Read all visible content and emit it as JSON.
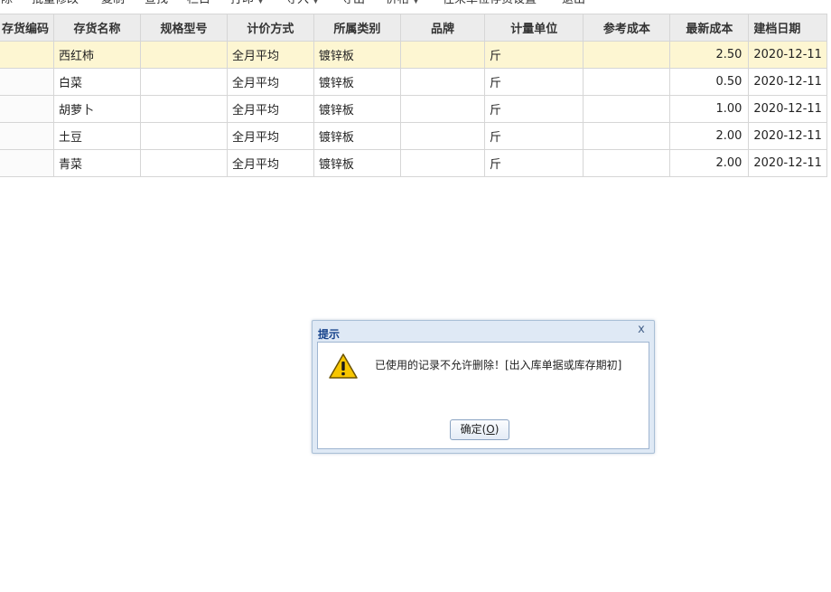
{
  "toolbar": {
    "items": [
      "删除",
      "批量修改",
      "复制",
      "查找",
      "栏目",
      "打印",
      "导入",
      "导出",
      "价格",
      "往来单位存货设置",
      "退出"
    ]
  },
  "table": {
    "columns": [
      "存货编码",
      "存货名称",
      "规格型号",
      "计价方式",
      "所属类别",
      "品牌",
      "计量单位",
      "参考成本",
      "最新成本",
      "建档日期"
    ],
    "rows": [
      {
        "code": "",
        "name": "西红柿",
        "spec": "",
        "valuation": "全月平均",
        "category": "镀锌板",
        "brand": "",
        "unit": "斤",
        "ref_cost": "",
        "latest_cost": "2.50",
        "date": "2020-12-11"
      },
      {
        "code": "",
        "name": "白菜",
        "spec": "",
        "valuation": "全月平均",
        "category": "镀锌板",
        "brand": "",
        "unit": "斤",
        "ref_cost": "",
        "latest_cost": "0.50",
        "date": "2020-12-11"
      },
      {
        "code": "",
        "name": "胡萝卜",
        "spec": "",
        "valuation": "全月平均",
        "category": "镀锌板",
        "brand": "",
        "unit": "斤",
        "ref_cost": "",
        "latest_cost": "1.00",
        "date": "2020-12-11"
      },
      {
        "code": "",
        "name": "土豆",
        "spec": "",
        "valuation": "全月平均",
        "category": "镀锌板",
        "brand": "",
        "unit": "斤",
        "ref_cost": "",
        "latest_cost": "2.00",
        "date": "2020-12-11"
      },
      {
        "code": "",
        "name": "青菜",
        "spec": "",
        "valuation": "全月平均",
        "category": "镀锌板",
        "brand": "",
        "unit": "斤",
        "ref_cost": "",
        "latest_cost": "2.00",
        "date": "2020-12-11"
      }
    ]
  },
  "dialog": {
    "title": "提示",
    "close_label": "x",
    "icon": "warning-icon",
    "message": "已使用的记录不允许删除！[出入库单据或库存期初]",
    "ok_label": "确定(",
    "ok_key": "O",
    "ok_suffix": ")"
  }
}
